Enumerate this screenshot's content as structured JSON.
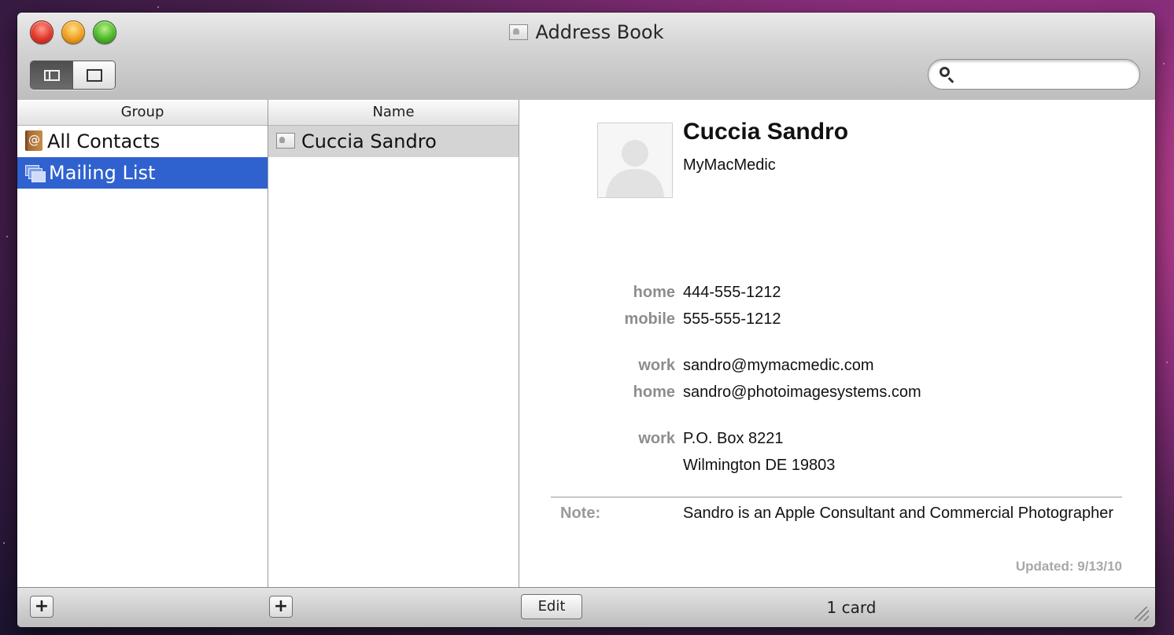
{
  "window": {
    "title": "Address Book"
  },
  "search": {
    "value": "",
    "placeholder": ""
  },
  "groups": {
    "header": "Group",
    "items": [
      {
        "label": "All Contacts",
        "icon": "address-book-icon",
        "selected": false
      },
      {
        "label": "Mailing List",
        "icon": "group-stack-icon",
        "selected": true
      }
    ]
  },
  "names": {
    "header": "Name",
    "items": [
      {
        "label": "Cuccia Sandro",
        "icon": "vcard-icon",
        "selected": true
      }
    ]
  },
  "card": {
    "name": "Cuccia Sandro",
    "company": "MyMacMedic",
    "phones": [
      {
        "label": "home",
        "value": "444-555-1212"
      },
      {
        "label": "mobile",
        "value": "555-555-1212"
      }
    ],
    "emails": [
      {
        "label": "work",
        "value": "sandro@mymacmedic.com"
      },
      {
        "label": "home",
        "value": "sandro@photoimagesystems.com"
      }
    ],
    "address": {
      "label": "work",
      "line1": "P.O. Box 8221",
      "line2": "Wilmington DE 19803"
    },
    "note_label": "Note:",
    "note": "Sandro is an Apple Consultant and Commercial Photographer",
    "updated": "Updated: 9/13/10"
  },
  "bottom": {
    "add_group": "+",
    "add_name": "+",
    "edit": "Edit",
    "count": "1 card"
  },
  "colors": {
    "selection_blue": "#2f62cf",
    "selection_gray": "#d4d4d4",
    "label_gray": "#8d8d8d"
  }
}
